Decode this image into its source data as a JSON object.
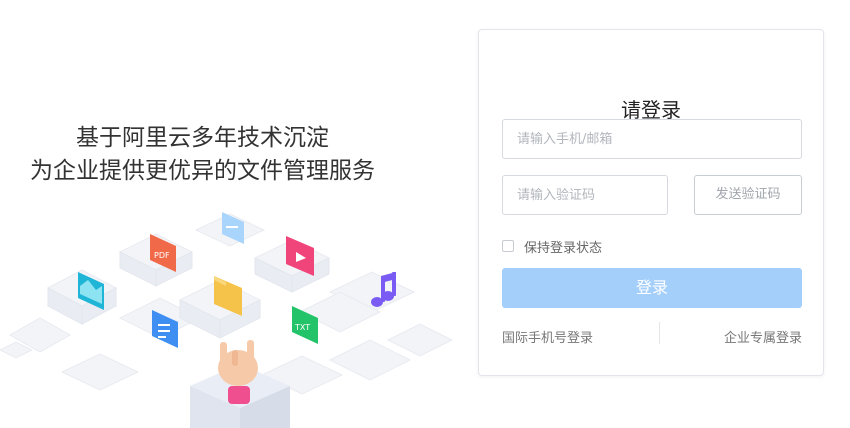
{
  "hero": {
    "line1": "基于阿里云多年技术沉淀",
    "line2": "为企业提供更优异的文件管理服务",
    "file_badges": {
      "pdf": "PDF",
      "txt": "TXT"
    }
  },
  "login": {
    "title": "请登录",
    "phone_placeholder": "请输入手机/邮箱",
    "code_placeholder": "请输入验证码",
    "send_code_label": "发送验证码",
    "remember_label": "保持登录状态",
    "submit_label": "登录",
    "intl_phone_link": "国际手机号登录",
    "enterprise_link": "企业专属登录"
  },
  "colors": {
    "primary_disabled": "#a5cffb",
    "card_border": "#e3e5ea",
    "text_dark": "#333333"
  }
}
